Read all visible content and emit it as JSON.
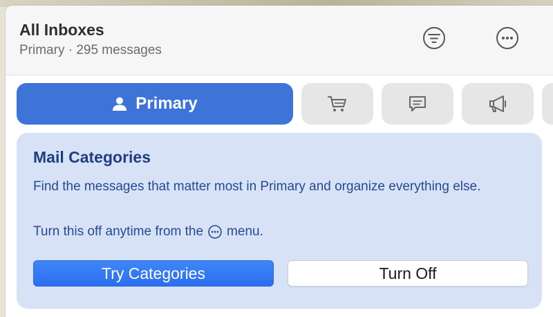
{
  "header": {
    "title": "All Inboxes",
    "subtitle": "Primary · 295 messages",
    "filter_icon": "filter-icon",
    "more_icon": "ellipsis-circle-icon"
  },
  "tabs": [
    {
      "id": "primary",
      "label": "Primary",
      "icon": "person-icon",
      "selected": true
    },
    {
      "id": "transactions",
      "label": "",
      "icon": "cart-icon",
      "selected": false
    },
    {
      "id": "updates",
      "label": "",
      "icon": "message-bubble-icon",
      "selected": false
    },
    {
      "id": "promotions",
      "label": "",
      "icon": "megaphone-icon",
      "selected": false
    }
  ],
  "card": {
    "title": "Mail Categories",
    "body": "Find the messages that matter most in Primary and organize everything else.",
    "hint_before": "Turn this off anytime from the",
    "hint_after": "menu.",
    "try_label": "Try Categories",
    "off_label": "Turn Off"
  },
  "colors": {
    "accent": "#3e74d8",
    "card_bg": "#d8e2f6",
    "card_text": "#234a92",
    "tab_bg": "#e6e6e6"
  }
}
